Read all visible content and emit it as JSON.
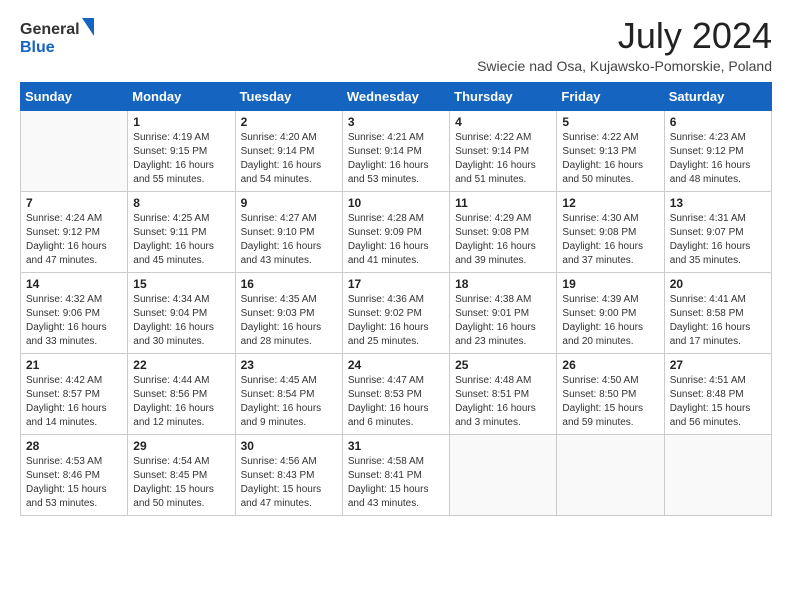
{
  "header": {
    "logo_general": "General",
    "logo_blue": "Blue",
    "month_year": "July 2024",
    "location": "Swiecie nad Osa, Kujawsko-Pomorskie, Poland"
  },
  "days_of_week": [
    "Sunday",
    "Monday",
    "Tuesday",
    "Wednesday",
    "Thursday",
    "Friday",
    "Saturday"
  ],
  "weeks": [
    [
      {
        "day": "",
        "info": ""
      },
      {
        "day": "1",
        "info": "Sunrise: 4:19 AM\nSunset: 9:15 PM\nDaylight: 16 hours\nand 55 minutes."
      },
      {
        "day": "2",
        "info": "Sunrise: 4:20 AM\nSunset: 9:14 PM\nDaylight: 16 hours\nand 54 minutes."
      },
      {
        "day": "3",
        "info": "Sunrise: 4:21 AM\nSunset: 9:14 PM\nDaylight: 16 hours\nand 53 minutes."
      },
      {
        "day": "4",
        "info": "Sunrise: 4:22 AM\nSunset: 9:14 PM\nDaylight: 16 hours\nand 51 minutes."
      },
      {
        "day": "5",
        "info": "Sunrise: 4:22 AM\nSunset: 9:13 PM\nDaylight: 16 hours\nand 50 minutes."
      },
      {
        "day": "6",
        "info": "Sunrise: 4:23 AM\nSunset: 9:12 PM\nDaylight: 16 hours\nand 48 minutes."
      }
    ],
    [
      {
        "day": "7",
        "info": "Sunrise: 4:24 AM\nSunset: 9:12 PM\nDaylight: 16 hours\nand 47 minutes."
      },
      {
        "day": "8",
        "info": "Sunrise: 4:25 AM\nSunset: 9:11 PM\nDaylight: 16 hours\nand 45 minutes."
      },
      {
        "day": "9",
        "info": "Sunrise: 4:27 AM\nSunset: 9:10 PM\nDaylight: 16 hours\nand 43 minutes."
      },
      {
        "day": "10",
        "info": "Sunrise: 4:28 AM\nSunset: 9:09 PM\nDaylight: 16 hours\nand 41 minutes."
      },
      {
        "day": "11",
        "info": "Sunrise: 4:29 AM\nSunset: 9:08 PM\nDaylight: 16 hours\nand 39 minutes."
      },
      {
        "day": "12",
        "info": "Sunrise: 4:30 AM\nSunset: 9:08 PM\nDaylight: 16 hours\nand 37 minutes."
      },
      {
        "day": "13",
        "info": "Sunrise: 4:31 AM\nSunset: 9:07 PM\nDaylight: 16 hours\nand 35 minutes."
      }
    ],
    [
      {
        "day": "14",
        "info": "Sunrise: 4:32 AM\nSunset: 9:06 PM\nDaylight: 16 hours\nand 33 minutes."
      },
      {
        "day": "15",
        "info": "Sunrise: 4:34 AM\nSunset: 9:04 PM\nDaylight: 16 hours\nand 30 minutes."
      },
      {
        "day": "16",
        "info": "Sunrise: 4:35 AM\nSunset: 9:03 PM\nDaylight: 16 hours\nand 28 minutes."
      },
      {
        "day": "17",
        "info": "Sunrise: 4:36 AM\nSunset: 9:02 PM\nDaylight: 16 hours\nand 25 minutes."
      },
      {
        "day": "18",
        "info": "Sunrise: 4:38 AM\nSunset: 9:01 PM\nDaylight: 16 hours\nand 23 minutes."
      },
      {
        "day": "19",
        "info": "Sunrise: 4:39 AM\nSunset: 9:00 PM\nDaylight: 16 hours\nand 20 minutes."
      },
      {
        "day": "20",
        "info": "Sunrise: 4:41 AM\nSunset: 8:58 PM\nDaylight: 16 hours\nand 17 minutes."
      }
    ],
    [
      {
        "day": "21",
        "info": "Sunrise: 4:42 AM\nSunset: 8:57 PM\nDaylight: 16 hours\nand 14 minutes."
      },
      {
        "day": "22",
        "info": "Sunrise: 4:44 AM\nSunset: 8:56 PM\nDaylight: 16 hours\nand 12 minutes."
      },
      {
        "day": "23",
        "info": "Sunrise: 4:45 AM\nSunset: 8:54 PM\nDaylight: 16 hours\nand 9 minutes."
      },
      {
        "day": "24",
        "info": "Sunrise: 4:47 AM\nSunset: 8:53 PM\nDaylight: 16 hours\nand 6 minutes."
      },
      {
        "day": "25",
        "info": "Sunrise: 4:48 AM\nSunset: 8:51 PM\nDaylight: 16 hours\nand 3 minutes."
      },
      {
        "day": "26",
        "info": "Sunrise: 4:50 AM\nSunset: 8:50 PM\nDaylight: 15 hours\nand 59 minutes."
      },
      {
        "day": "27",
        "info": "Sunrise: 4:51 AM\nSunset: 8:48 PM\nDaylight: 15 hours\nand 56 minutes."
      }
    ],
    [
      {
        "day": "28",
        "info": "Sunrise: 4:53 AM\nSunset: 8:46 PM\nDaylight: 15 hours\nand 53 minutes."
      },
      {
        "day": "29",
        "info": "Sunrise: 4:54 AM\nSunset: 8:45 PM\nDaylight: 15 hours\nand 50 minutes."
      },
      {
        "day": "30",
        "info": "Sunrise: 4:56 AM\nSunset: 8:43 PM\nDaylight: 15 hours\nand 47 minutes."
      },
      {
        "day": "31",
        "info": "Sunrise: 4:58 AM\nSunset: 8:41 PM\nDaylight: 15 hours\nand 43 minutes."
      },
      {
        "day": "",
        "info": ""
      },
      {
        "day": "",
        "info": ""
      },
      {
        "day": "",
        "info": ""
      }
    ]
  ]
}
